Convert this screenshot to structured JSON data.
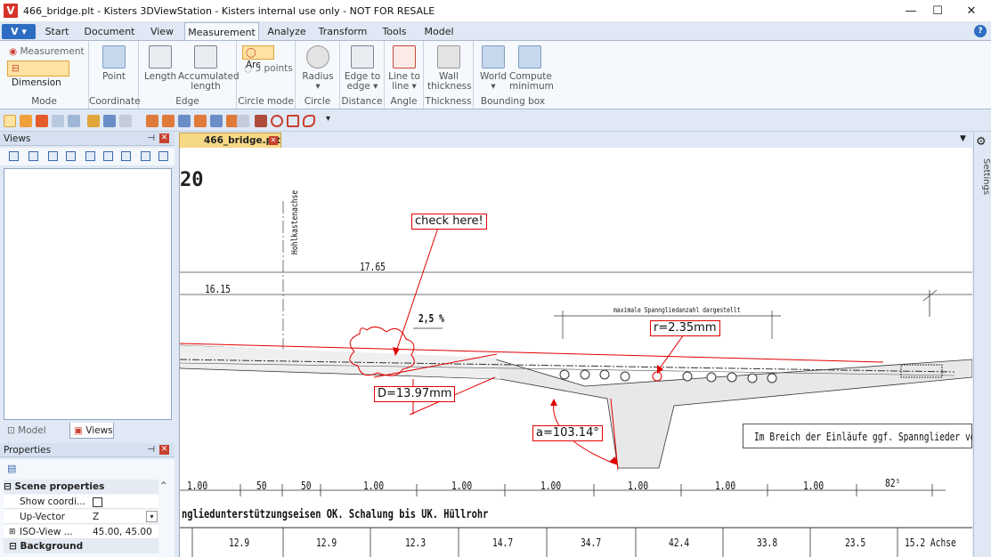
{
  "window": {
    "title": "466_bridge.plt - Kisters 3DViewStation - Kisters internal use only - NOT FOR RESALE",
    "app_icon_letter": "V",
    "minimize": "—",
    "maximize": "☐",
    "close": "✕"
  },
  "menu_button": "V ▾",
  "tabs": [
    "Start",
    "Document",
    "View",
    "Measurement",
    "Analyze",
    "Transform",
    "Tools",
    "Model"
  ],
  "help": "?",
  "ribbon": {
    "mode": {
      "measurement": "Measurement",
      "dimension": "Dimension",
      "label": "Mode"
    },
    "coordinate": {
      "point": "Point",
      "label": "Coordinate"
    },
    "edge": {
      "length": "Length",
      "accumulated_1": "Accumulated",
      "accumulated_2": "length",
      "label": "Edge"
    },
    "circle_mode": {
      "arc": "Arc",
      "three_points": "3 points",
      "label": "Circle mode"
    },
    "circle": {
      "radius": "Radius",
      "radius_arrow": "▾",
      "label": "Circle"
    },
    "distance": {
      "edge_to_1": "Edge to",
      "edge_to_2": "edge ▾",
      "label": "Distance"
    },
    "angle": {
      "line_to_1": "Line to",
      "line_to_2": "line ▾",
      "label": "Angle"
    },
    "thickness": {
      "wall_1": "Wall",
      "wall_2": "thickness",
      "label": "Thickness"
    },
    "bounding_box": {
      "world": "World",
      "world_arrow": "▾",
      "compute_1": "Compute",
      "compute_2": "minimum",
      "label": "Bounding box"
    }
  },
  "views_panel": {
    "title": "Views",
    "pin": "⊣",
    "close": "✕"
  },
  "panel_tabs": {
    "model_tree": "Model tree",
    "views": "Views"
  },
  "properties": {
    "title": "Properties",
    "scene_properties": "Scene properties",
    "show_coordi": "Show coordi...",
    "up_vector": "Up-Vector",
    "up_vector_value": "Z",
    "iso_view": "ISO-View ...",
    "iso_view_value": "45.00, 45.00",
    "background": "Background"
  },
  "document_tab": "466_bridge.plt",
  "settings_label": "Settings",
  "drawing": {
    "title_fragment": "20",
    "hohlkasten": "Hohlkastenachse",
    "dim_17_65": "17.65",
    "dim_16_15": "16.15",
    "slope": "2,5 %",
    "max_spann": "maximale Spanngliedanzahl dargestellt",
    "note_einlaeufe": "Im Breich der Einläufe ggf. Spannglieder verziehen !",
    "bottom_dims": [
      "1.00",
      "50",
      "50",
      "1.00",
      "1.00",
      "1.00",
      "1.00",
      "1.00",
      "1.00",
      "82⁵"
    ],
    "caption": "ngliedunterstützungseisen OK. Schalung bis UK. Hüllrohr",
    "table_values": [
      "12.9",
      "12.9",
      "12.3",
      "14.7",
      "34.7",
      "42.4",
      "33.8",
      "23.5",
      "15.2 Achse"
    ]
  },
  "annotations": {
    "check": "check here!",
    "radius": "r=2.35mm",
    "diameter": "D=13.97mm",
    "angle": "a=103.14°"
  },
  "colors": {
    "annotation_red": "#e00000",
    "highlight": "#fde2a2",
    "ribbon_bg": "#f5f8fc",
    "frame_bg": "#dfe8f4"
  }
}
